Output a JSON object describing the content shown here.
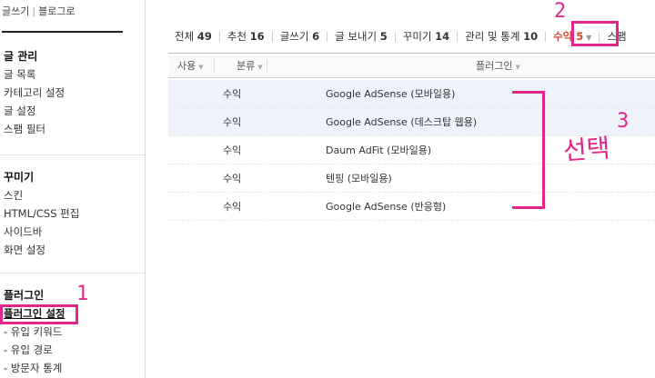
{
  "sidebar": {
    "top_links": [
      "글쓰기",
      "블로그로"
    ],
    "sections": [
      {
        "title": "글 관리",
        "items": [
          "글 목록",
          "카테고리 설정",
          "글 설정",
          "스팸 필터"
        ]
      },
      {
        "title": "꾸미기",
        "items": [
          "스킨",
          "HTML/CSS 편집",
          "사이드바",
          "화면 설정"
        ]
      },
      {
        "title": "플러그인",
        "items": [
          "플러그인 설정",
          "- 유입 키워드",
          "- 유입 경로",
          "- 방문자 통계"
        ]
      }
    ]
  },
  "tabs": [
    {
      "label": "전체",
      "count": "49"
    },
    {
      "label": "추천",
      "count": "16"
    },
    {
      "label": "글쓰기",
      "count": "6"
    },
    {
      "label": "글 보내기",
      "count": "5"
    },
    {
      "label": "꾸미기",
      "count": "14"
    },
    {
      "label": "관리 및 통계",
      "count": "10"
    },
    {
      "label": "수익",
      "count": "5"
    },
    {
      "label": "스팸",
      "count": ""
    }
  ],
  "table": {
    "headers": {
      "use": "사용",
      "category": "분류",
      "plugin": "플러그인"
    },
    "rows": [
      {
        "category": "수익",
        "name": "Google AdSense (모바일용)"
      },
      {
        "category": "수익",
        "name": "Google AdSense (데스크탑 웹용)"
      },
      {
        "category": "수익",
        "name": "Daum AdFit (모바일용)"
      },
      {
        "category": "수익",
        "name": "텐핑 (모바일용)"
      },
      {
        "category": "수익",
        "name": "Google AdSense (반응형)"
      }
    ]
  },
  "annotations": {
    "step1": "1",
    "step2": "2",
    "step3": "3",
    "select_label": "선택"
  },
  "colors": {
    "annotation": "#e0288c",
    "active_tab": "#d9442a",
    "selected_row": "#eef2fb"
  }
}
